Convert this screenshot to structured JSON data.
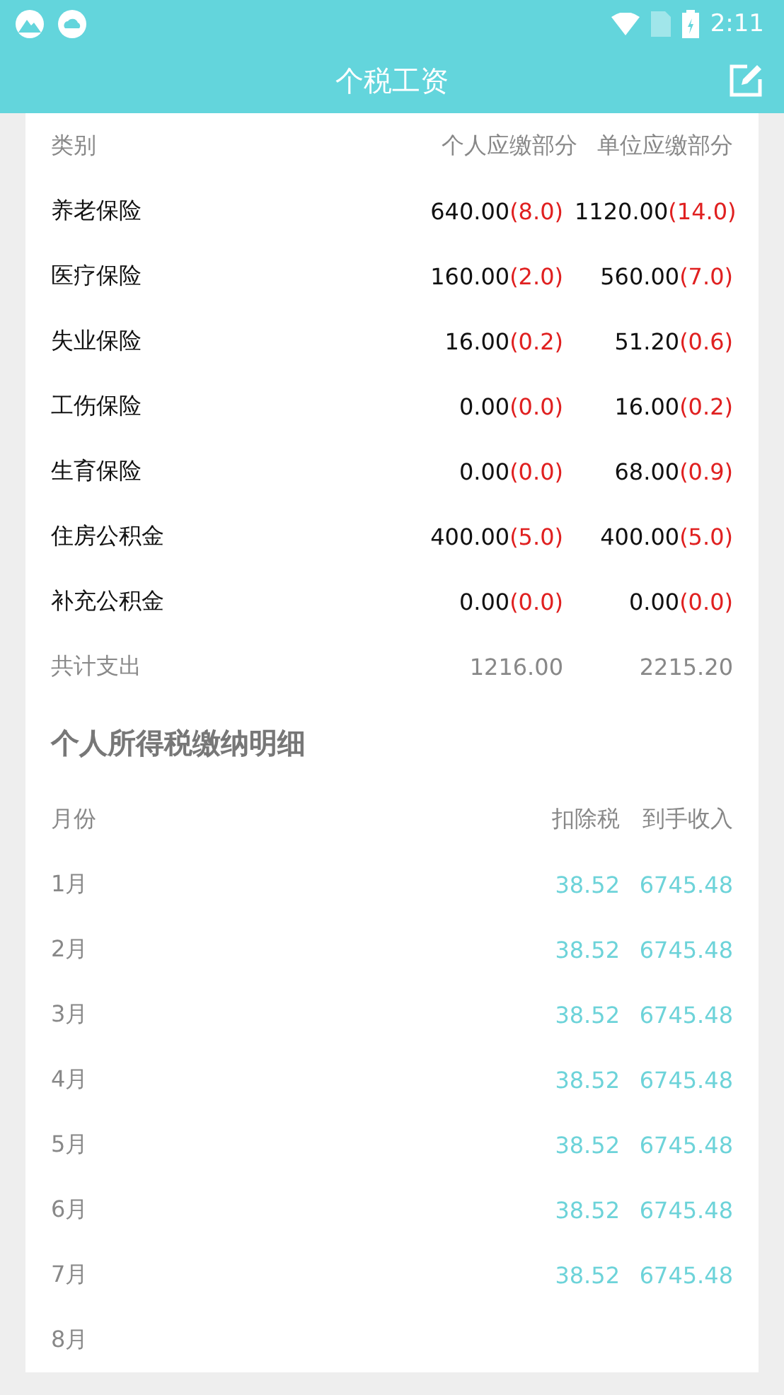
{
  "status_bar": {
    "time": "2:11"
  },
  "toolbar": {
    "title": "个税工资"
  },
  "insurance": {
    "columns": [
      "类别",
      "个人应缴部分",
      "单位应缴部分"
    ],
    "rows": [
      {
        "name": "养老保险",
        "personal": {
          "amount": "640.00",
          "rate": "(8.0)"
        },
        "company": {
          "amount": "1120.00",
          "rate": "(14.0)"
        }
      },
      {
        "name": "医疗保险",
        "personal": {
          "amount": "160.00",
          "rate": "(2.0)"
        },
        "company": {
          "amount": "560.00",
          "rate": "(7.0)"
        }
      },
      {
        "name": "失业保险",
        "personal": {
          "amount": "16.00",
          "rate": "(0.2)"
        },
        "company": {
          "amount": "51.20",
          "rate": "(0.6)"
        }
      },
      {
        "name": "工伤保险",
        "personal": {
          "amount": "0.00",
          "rate": "(0.0)"
        },
        "company": {
          "amount": "16.00",
          "rate": "(0.2)"
        }
      },
      {
        "name": "生育保险",
        "personal": {
          "amount": "0.00",
          "rate": "(0.0)"
        },
        "company": {
          "amount": "68.00",
          "rate": "(0.9)"
        }
      },
      {
        "name": "住房公积金",
        "personal": {
          "amount": "400.00",
          "rate": "(5.0)"
        },
        "company": {
          "amount": "400.00",
          "rate": "(5.0)"
        }
      },
      {
        "name": "补充公积金",
        "personal": {
          "amount": "0.00",
          "rate": "(0.0)"
        },
        "company": {
          "amount": "0.00",
          "rate": "(0.0)"
        }
      }
    ],
    "total": {
      "label": "共计支出",
      "personal": "1216.00",
      "company": "2215.20"
    }
  },
  "tax": {
    "title": "个人所得税缴纳明细",
    "columns": [
      "月份",
      "扣除税",
      "到手收入"
    ],
    "rows": [
      {
        "month": "1月",
        "tax": "38.52",
        "income": "6745.48"
      },
      {
        "month": "2月",
        "tax": "38.52",
        "income": "6745.48"
      },
      {
        "month": "3月",
        "tax": "38.52",
        "income": "6745.48"
      },
      {
        "month": "4月",
        "tax": "38.52",
        "income": "6745.48"
      },
      {
        "month": "5月",
        "tax": "38.52",
        "income": "6745.48"
      },
      {
        "month": "6月",
        "tax": "38.52",
        "income": "6745.48"
      },
      {
        "month": "7月",
        "tax": "38.52",
        "income": "6745.48"
      },
      {
        "month": "8月"
      }
    ]
  }
}
